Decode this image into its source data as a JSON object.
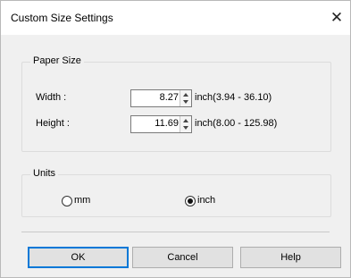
{
  "window": {
    "title": "Custom Size Settings",
    "close_glyph": "✕"
  },
  "paper_size": {
    "group_title": "Paper Size",
    "width": {
      "label": "Width :",
      "value": "8.27",
      "range": "inch(3.94 - 36.10)"
    },
    "height": {
      "label": "Height :",
      "value": "11.69",
      "range": "inch(8.00 - 125.98)"
    }
  },
  "units": {
    "group_title": "Units",
    "options": [
      {
        "label": "mm",
        "selected": false
      },
      {
        "label": "inch",
        "selected": true
      }
    ]
  },
  "buttons": {
    "ok": "OK",
    "cancel": "Cancel",
    "help": "Help"
  },
  "colors": {
    "default_button_border": "#0078d7",
    "dialog_bg": "#f0f0f0"
  }
}
